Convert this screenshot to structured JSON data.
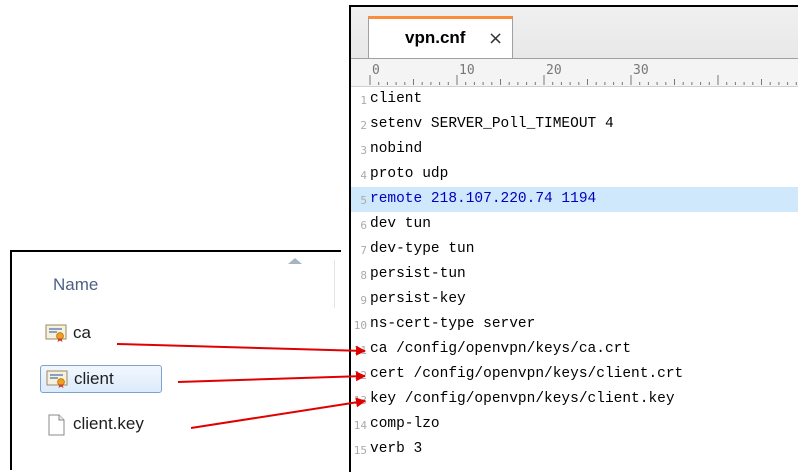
{
  "explorer": {
    "column_header": "Name",
    "files": [
      {
        "name": "ca",
        "icon": "certificate-icon",
        "selected": false
      },
      {
        "name": "client",
        "icon": "certificate-icon",
        "selected": true
      },
      {
        "name": "client.key",
        "icon": "blank-file-icon",
        "selected": false
      }
    ]
  },
  "editor": {
    "tab_title": "vpn.cnf",
    "tab_close": "×",
    "ruler": {
      "ticks": [
        "0",
        "10",
        "20",
        "30"
      ]
    },
    "highlight_color": "#cfe8fc",
    "lines": [
      {
        "n": "1",
        "text": "client"
      },
      {
        "n": "2",
        "text": "setenv SERVER_Poll_TIMEOUT 4"
      },
      {
        "n": "3",
        "text": "nobind"
      },
      {
        "n": "4",
        "text": "proto udp"
      },
      {
        "n": "5",
        "text": "remote 218.107.220.74 1194"
      },
      {
        "n": "6",
        "text": "dev tun"
      },
      {
        "n": "7",
        "text": "dev-type tun"
      },
      {
        "n": "8",
        "text": "persist-tun"
      },
      {
        "n": "9",
        "text": "persist-key"
      },
      {
        "n": "10",
        "text": "ns-cert-type server"
      },
      {
        "n": "11",
        "text": "ca /config/openvpn/keys/ca.crt"
      },
      {
        "n": "12",
        "text": "cert /config/openvpn/keys/client.crt"
      },
      {
        "n": "13",
        "text": "key /config/openvpn/keys/client.key"
      },
      {
        "n": "14",
        "text": "comp-lzo"
      },
      {
        "n": "15",
        "text": "verb 3"
      }
    ]
  },
  "annotation_color": "#e00000"
}
